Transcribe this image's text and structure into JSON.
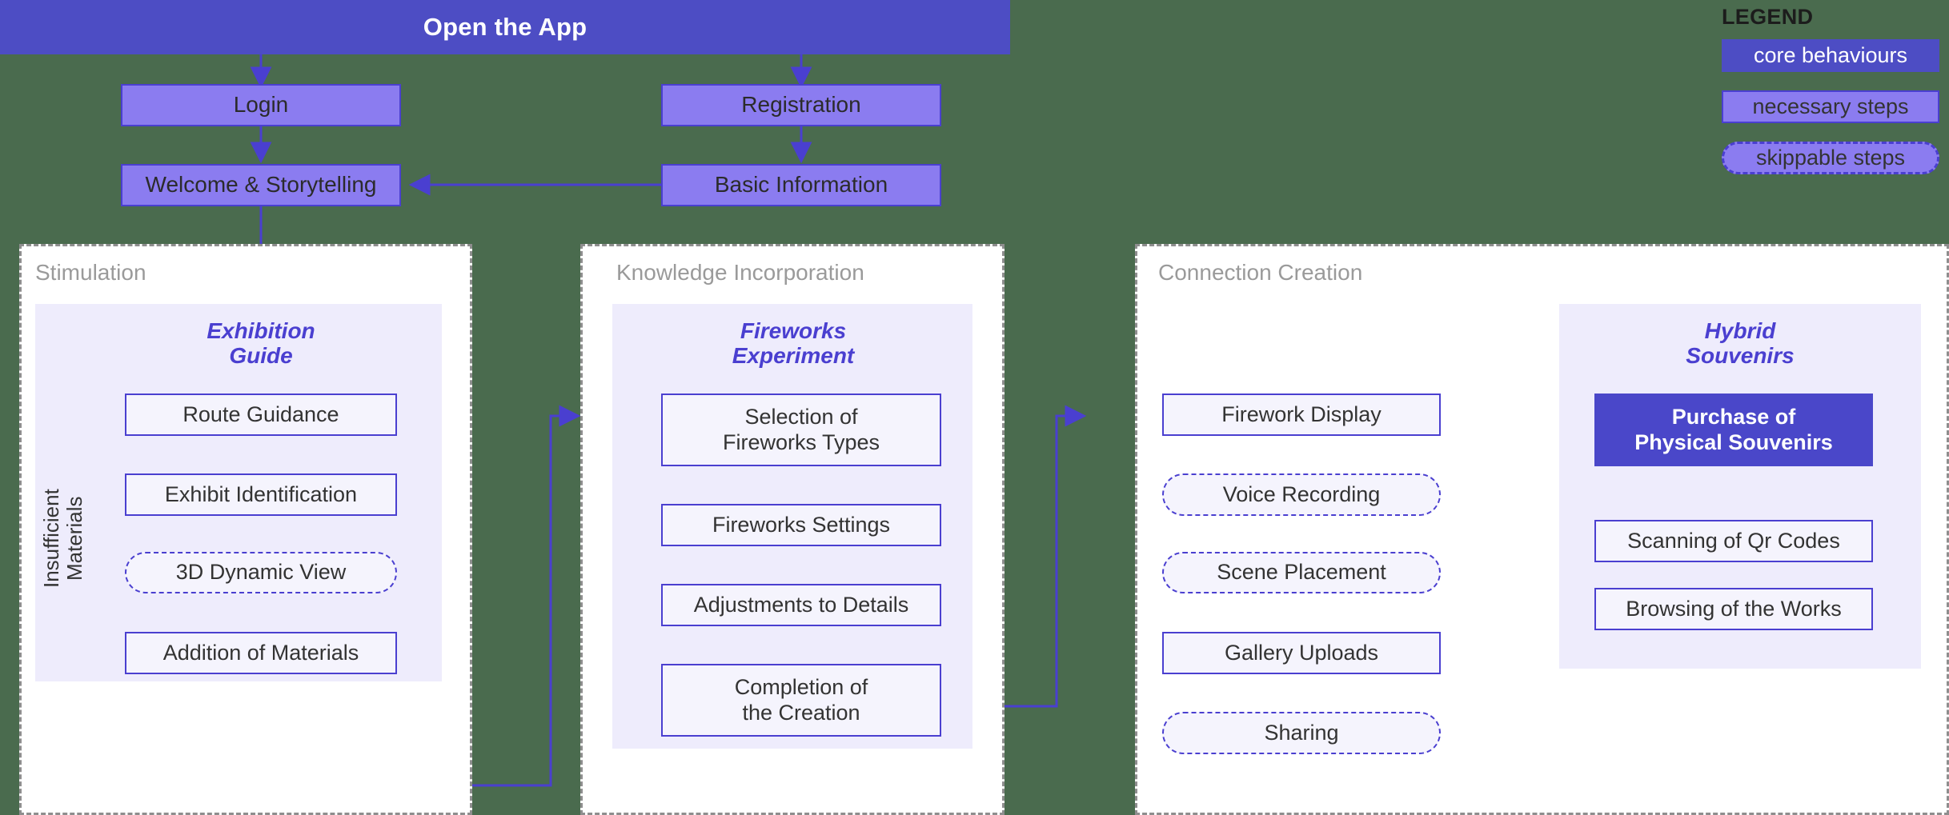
{
  "banner": {
    "label": "Open the App"
  },
  "colors": {
    "accent_dark": "#4d4dc4",
    "accent_mid": "#8b7cf0",
    "accent_line": "#4a3fd0",
    "group_bg": "#eeecfc",
    "step_bg": "#f5f4fd",
    "panel_border": "#8e8e8e",
    "canvas_bg": "#4a6b4e"
  },
  "entry_flow": [
    {
      "id": "login",
      "label": "Login",
      "type": "necessary"
    },
    {
      "id": "registration",
      "label": "Registration",
      "type": "necessary"
    },
    {
      "id": "welcome",
      "label": "Welcome & Storytelling",
      "type": "necessary"
    },
    {
      "id": "basic_info",
      "label": "Basic Information",
      "type": "necessary"
    }
  ],
  "panels": [
    {
      "id": "stimulation",
      "title": "Stimulation",
      "loop_label": "Insufficient\nMaterials",
      "group": {
        "title": "Exhibition\nGuide",
        "steps": [
          {
            "label": "Route Guidance",
            "type": "necessary"
          },
          {
            "label": "Exhibit Identification",
            "type": "necessary"
          },
          {
            "label": "3D Dynamic View",
            "type": "skippable"
          },
          {
            "label": "Addition of Materials",
            "type": "necessary"
          }
        ]
      }
    },
    {
      "id": "knowledge_incorporation",
      "title": "Knowledge Incorporation",
      "group": {
        "title": "Fireworks\nExperiment",
        "steps": [
          {
            "label": "Selection of\nFireworks Types",
            "type": "necessary"
          },
          {
            "label": "Fireworks Settings",
            "type": "necessary"
          },
          {
            "label": "Adjustments to Details",
            "type": "necessary"
          },
          {
            "label": "Completion of\nthe Creation",
            "type": "necessary"
          }
        ]
      }
    },
    {
      "id": "connection_creation",
      "title": "Connection Creation",
      "column": [
        {
          "label": "Firework Display",
          "type": "necessary"
        },
        {
          "label": "Voice Recording",
          "type": "skippable"
        },
        {
          "label": "Scene Placement",
          "type": "skippable"
        },
        {
          "label": "Gallery Uploads",
          "type": "necessary"
        },
        {
          "label": "Sharing",
          "type": "skippable"
        }
      ],
      "group": {
        "title": "Hybrid\nSouvenirs",
        "steps": [
          {
            "label": "Purchase of\nPhysical Souvenirs",
            "type": "core"
          },
          {
            "label": "Scanning of Qr Codes",
            "type": "necessary"
          },
          {
            "label": "Browsing of the Works",
            "type": "necessary"
          }
        ]
      }
    }
  ],
  "legend": {
    "title": "LEGEND",
    "items": [
      {
        "label": "core behaviours",
        "type": "core"
      },
      {
        "label": "necessary steps",
        "type": "necessary"
      },
      {
        "label": "skippable steps",
        "type": "skippable"
      }
    ]
  }
}
